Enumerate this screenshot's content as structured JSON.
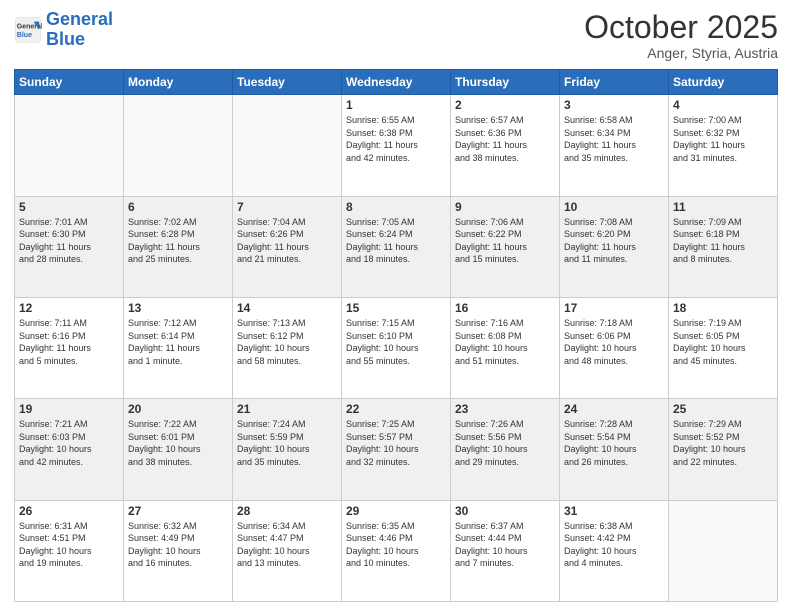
{
  "header": {
    "logo_general": "General",
    "logo_blue": "Blue",
    "month": "October 2025",
    "location": "Anger, Styria, Austria"
  },
  "days_of_week": [
    "Sunday",
    "Monday",
    "Tuesday",
    "Wednesday",
    "Thursday",
    "Friday",
    "Saturday"
  ],
  "weeks": [
    [
      {
        "day": "",
        "info": ""
      },
      {
        "day": "",
        "info": ""
      },
      {
        "day": "",
        "info": ""
      },
      {
        "day": "1",
        "info": "Sunrise: 6:55 AM\nSunset: 6:38 PM\nDaylight: 11 hours\nand 42 minutes."
      },
      {
        "day": "2",
        "info": "Sunrise: 6:57 AM\nSunset: 6:36 PM\nDaylight: 11 hours\nand 38 minutes."
      },
      {
        "day": "3",
        "info": "Sunrise: 6:58 AM\nSunset: 6:34 PM\nDaylight: 11 hours\nand 35 minutes."
      },
      {
        "day": "4",
        "info": "Sunrise: 7:00 AM\nSunset: 6:32 PM\nDaylight: 11 hours\nand 31 minutes."
      }
    ],
    [
      {
        "day": "5",
        "info": "Sunrise: 7:01 AM\nSunset: 6:30 PM\nDaylight: 11 hours\nand 28 minutes."
      },
      {
        "day": "6",
        "info": "Sunrise: 7:02 AM\nSunset: 6:28 PM\nDaylight: 11 hours\nand 25 minutes."
      },
      {
        "day": "7",
        "info": "Sunrise: 7:04 AM\nSunset: 6:26 PM\nDaylight: 11 hours\nand 21 minutes."
      },
      {
        "day": "8",
        "info": "Sunrise: 7:05 AM\nSunset: 6:24 PM\nDaylight: 11 hours\nand 18 minutes."
      },
      {
        "day": "9",
        "info": "Sunrise: 7:06 AM\nSunset: 6:22 PM\nDaylight: 11 hours\nand 15 minutes."
      },
      {
        "day": "10",
        "info": "Sunrise: 7:08 AM\nSunset: 6:20 PM\nDaylight: 11 hours\nand 11 minutes."
      },
      {
        "day": "11",
        "info": "Sunrise: 7:09 AM\nSunset: 6:18 PM\nDaylight: 11 hours\nand 8 minutes."
      }
    ],
    [
      {
        "day": "12",
        "info": "Sunrise: 7:11 AM\nSunset: 6:16 PM\nDaylight: 11 hours\nand 5 minutes."
      },
      {
        "day": "13",
        "info": "Sunrise: 7:12 AM\nSunset: 6:14 PM\nDaylight: 11 hours\nand 1 minute."
      },
      {
        "day": "14",
        "info": "Sunrise: 7:13 AM\nSunset: 6:12 PM\nDaylight: 10 hours\nand 58 minutes."
      },
      {
        "day": "15",
        "info": "Sunrise: 7:15 AM\nSunset: 6:10 PM\nDaylight: 10 hours\nand 55 minutes."
      },
      {
        "day": "16",
        "info": "Sunrise: 7:16 AM\nSunset: 6:08 PM\nDaylight: 10 hours\nand 51 minutes."
      },
      {
        "day": "17",
        "info": "Sunrise: 7:18 AM\nSunset: 6:06 PM\nDaylight: 10 hours\nand 48 minutes."
      },
      {
        "day": "18",
        "info": "Sunrise: 7:19 AM\nSunset: 6:05 PM\nDaylight: 10 hours\nand 45 minutes."
      }
    ],
    [
      {
        "day": "19",
        "info": "Sunrise: 7:21 AM\nSunset: 6:03 PM\nDaylight: 10 hours\nand 42 minutes."
      },
      {
        "day": "20",
        "info": "Sunrise: 7:22 AM\nSunset: 6:01 PM\nDaylight: 10 hours\nand 38 minutes."
      },
      {
        "day": "21",
        "info": "Sunrise: 7:24 AM\nSunset: 5:59 PM\nDaylight: 10 hours\nand 35 minutes."
      },
      {
        "day": "22",
        "info": "Sunrise: 7:25 AM\nSunset: 5:57 PM\nDaylight: 10 hours\nand 32 minutes."
      },
      {
        "day": "23",
        "info": "Sunrise: 7:26 AM\nSunset: 5:56 PM\nDaylight: 10 hours\nand 29 minutes."
      },
      {
        "day": "24",
        "info": "Sunrise: 7:28 AM\nSunset: 5:54 PM\nDaylight: 10 hours\nand 26 minutes."
      },
      {
        "day": "25",
        "info": "Sunrise: 7:29 AM\nSunset: 5:52 PM\nDaylight: 10 hours\nand 22 minutes."
      }
    ],
    [
      {
        "day": "26",
        "info": "Sunrise: 6:31 AM\nSunset: 4:51 PM\nDaylight: 10 hours\nand 19 minutes."
      },
      {
        "day": "27",
        "info": "Sunrise: 6:32 AM\nSunset: 4:49 PM\nDaylight: 10 hours\nand 16 minutes."
      },
      {
        "day": "28",
        "info": "Sunrise: 6:34 AM\nSunset: 4:47 PM\nDaylight: 10 hours\nand 13 minutes."
      },
      {
        "day": "29",
        "info": "Sunrise: 6:35 AM\nSunset: 4:46 PM\nDaylight: 10 hours\nand 10 minutes."
      },
      {
        "day": "30",
        "info": "Sunrise: 6:37 AM\nSunset: 4:44 PM\nDaylight: 10 hours\nand 7 minutes."
      },
      {
        "day": "31",
        "info": "Sunrise: 6:38 AM\nSunset: 4:42 PM\nDaylight: 10 hours\nand 4 minutes."
      },
      {
        "day": "",
        "info": ""
      }
    ]
  ]
}
